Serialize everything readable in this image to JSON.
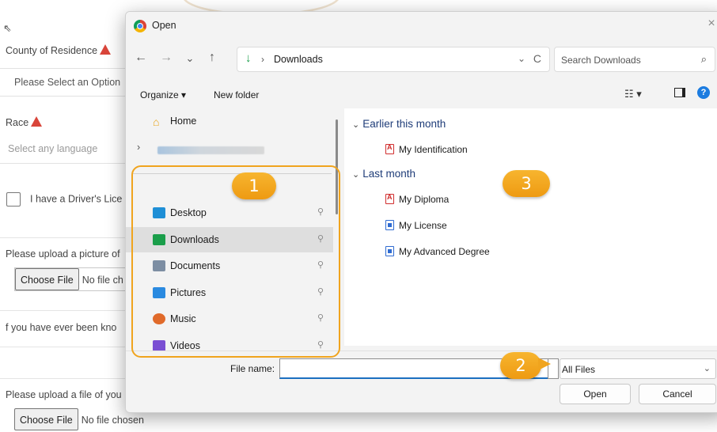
{
  "background_form": {
    "county_label": "County of Residence",
    "county_select": "Please Select an Option",
    "race_label": "Race",
    "language_placeholder": "Select any language",
    "drivers_license_label": "I have a Driver's Lice",
    "upload_picture_label": "Please upload a picture of",
    "choose_file_1": "Choose File",
    "no_file_1": "No file ch",
    "known_as_label": "f you have ever been kno",
    "upload_file_label": "Please upload a file of you",
    "choose_file_2": "Choose File",
    "no_file_2": "No file chosen"
  },
  "dialog": {
    "title": "Open",
    "close": "×",
    "nav": {
      "back": "←",
      "forward": "→",
      "recent": "⌄",
      "up": "↑"
    },
    "address": {
      "separator": "›",
      "location": "Downloads",
      "dropdown": "⌄",
      "refresh": "C"
    },
    "search_placeholder": "Search Downloads",
    "search_icon": "⌕",
    "toolbar": {
      "organize": "Organize ▾",
      "new_folder": "New folder",
      "view": "☷ ▾",
      "help": "?"
    },
    "sidebar": {
      "home": "Home",
      "expand": "›",
      "quick_access": [
        {
          "label": "Desktop",
          "icon": "desktop-icon",
          "color": "#1f8fd6",
          "pin": "📌"
        },
        {
          "label": "Downloads",
          "icon": "downloads-icon",
          "color": "#1a9e4a",
          "pin": "📌"
        },
        {
          "label": "Documents",
          "icon": "documents-icon",
          "color": "#7d8ea3",
          "pin": "📌"
        },
        {
          "label": "Pictures",
          "icon": "pictures-icon",
          "color": "#2a8ae0",
          "pin": "📌"
        },
        {
          "label": "Music",
          "icon": "music-icon",
          "color": "#e06a2a",
          "pin": "📌"
        },
        {
          "label": "Videos",
          "icon": "videos-icon",
          "color": "#7a4fd3",
          "pin": "📌"
        }
      ]
    },
    "groups": [
      {
        "heading": "Earlier this month",
        "files": [
          {
            "name": "My Identification",
            "type": "pdf"
          }
        ]
      },
      {
        "heading": "Last month",
        "files": [
          {
            "name": "My Diploma",
            "type": "pdf"
          },
          {
            "name": "My License",
            "type": "doc"
          },
          {
            "name": "My Advanced Degree",
            "type": "doc"
          }
        ]
      }
    ],
    "footer": {
      "file_name_label": "File name:",
      "file_name_value": "",
      "file_type": "All Files",
      "open_button": "Open",
      "cancel_button": "Cancel"
    }
  },
  "annotations": {
    "badge_1": "1",
    "badge_2": "2",
    "badge_3": "3",
    "accent": "#f0a41e"
  }
}
